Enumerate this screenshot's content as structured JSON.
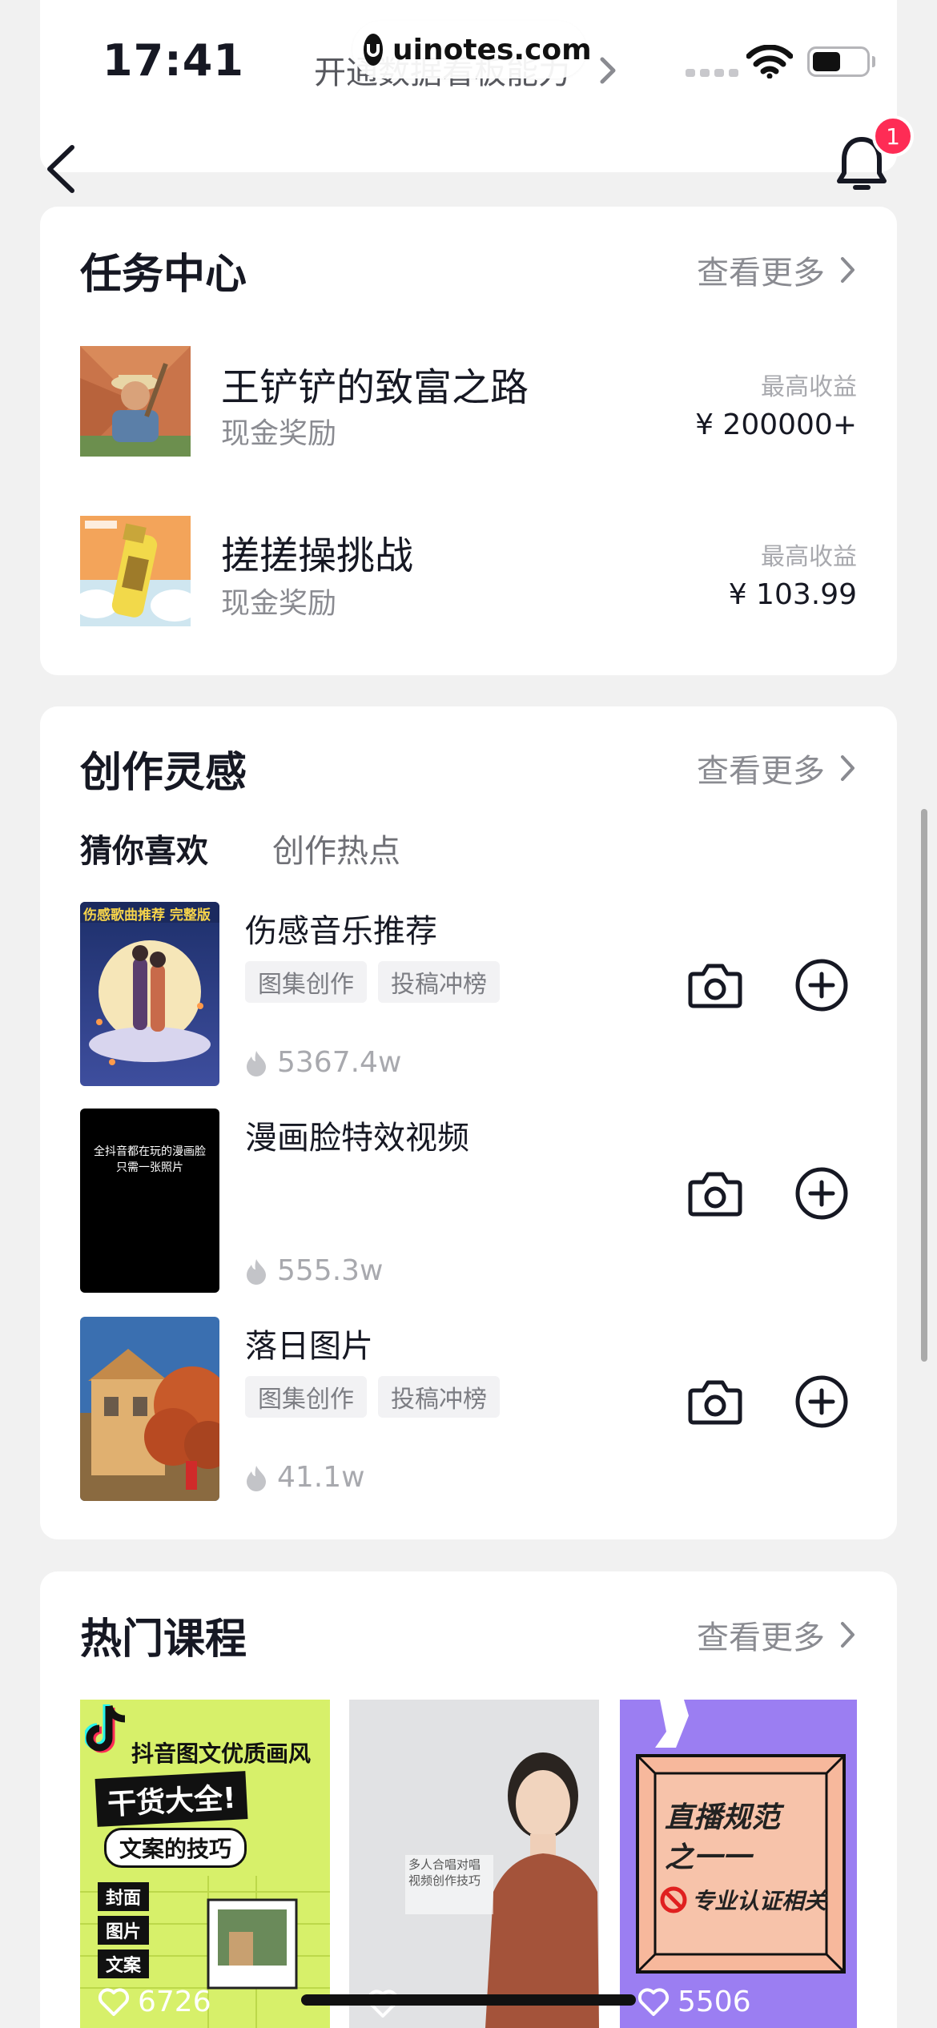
{
  "status_bar": {
    "time": "17:41"
  },
  "header": {
    "subtitle": "开通数据看板能力",
    "watermark": "uinotes.com",
    "notification_count": "1"
  },
  "task_center": {
    "title": "任务中心",
    "more": "查看更多",
    "items": [
      {
        "title": "王铲铲的致富之路",
        "subtitle": "现金奖励",
        "reward_label": "最高收益",
        "reward_value": "¥ 200000+"
      },
      {
        "title": "搓搓操挑战",
        "subtitle": "现金奖励",
        "reward_label": "最高收益",
        "reward_value": "¥ 103.99"
      }
    ]
  },
  "inspiration": {
    "title": "创作灵感",
    "more": "查看更多",
    "tabs": [
      {
        "label": "猜你喜欢",
        "active": true
      },
      {
        "label": "创作热点",
        "active": false
      }
    ],
    "items": [
      {
        "title": "伤感音乐推荐",
        "tags": [
          "图集创作",
          "投稿冲榜"
        ],
        "heat": "5367.4w",
        "thumb_text": "伤感歌曲推荐 完整版"
      },
      {
        "title": "漫画脸特效视频",
        "tags": [],
        "heat": "555.3w",
        "thumb_text": "全抖音都在玩的漫画脸 只需一张照片"
      },
      {
        "title": "落日图片",
        "tags": [
          "图集创作",
          "投稿冲榜"
        ],
        "heat": "41.1w"
      }
    ]
  },
  "courses": {
    "title": "热门课程",
    "more": "查看更多",
    "items": [
      {
        "likes": "6726",
        "lines": [
          "抖音图文优质画风",
          "干货大全!",
          "文案的技巧",
          "封面",
          "图片",
          "文案"
        ]
      },
      {
        "likes": "",
        "caption": "多人合唱对唱 视频创作技巧"
      },
      {
        "likes": "5506",
        "lines": [
          "直播规范",
          "之一一",
          "专业认证相关"
        ]
      }
    ]
  },
  "colors": {
    "accent": "#fe2c55",
    "text_primary": "#161823",
    "text_secondary": "#8a8b91"
  }
}
